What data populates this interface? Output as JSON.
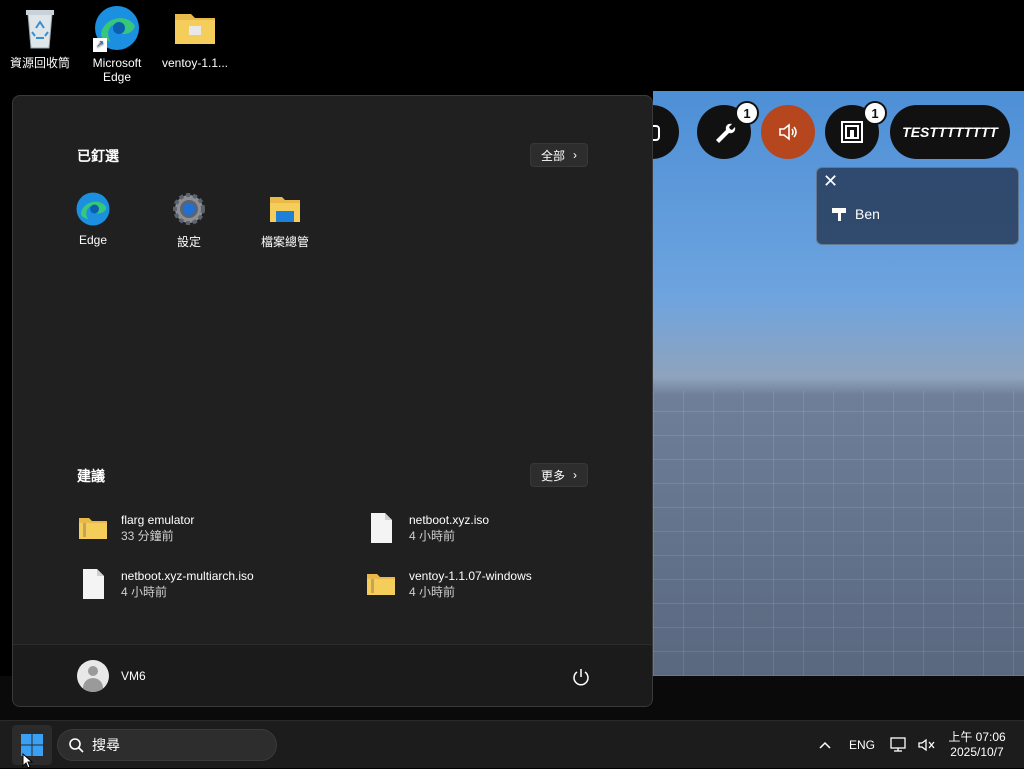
{
  "desktop_icons": [
    {
      "label": "資源回收筒",
      "icon": "recycle-bin-icon"
    },
    {
      "label": "Microsoft\nEdge",
      "icon": "edge-icon"
    },
    {
      "label": "ventoy-1.1...",
      "icon": "folder-icon"
    }
  ],
  "start_menu": {
    "pinned_title": "已釘選",
    "pinned_all_label": "全部",
    "pinned": [
      {
        "label": "Edge",
        "icon": "edge-icon"
      },
      {
        "label": "設定",
        "icon": "settings-gear-icon"
      },
      {
        "label": "檔案總管",
        "icon": "file-explorer-icon"
      }
    ],
    "recommended_title": "建議",
    "recommended_more_label": "更多",
    "recommended": [
      {
        "name": "flarg emulator",
        "time": "33 分鐘前",
        "icon": "zip-folder-icon"
      },
      {
        "name": "netboot.xyz.iso",
        "time": "4 小時前",
        "icon": "file-icon"
      },
      {
        "name": "netboot.xyz-multiarch.iso",
        "time": "4 小時前",
        "icon": "file-icon"
      },
      {
        "name": "ventoy-1.1.07-windows",
        "time": "4 小時前",
        "icon": "zip-folder-icon"
      }
    ],
    "user_name": "VM6"
  },
  "game": {
    "badge_tools": "1",
    "badge_inventory": "1",
    "player_tag": "TESTTTTTTTT",
    "notification_name": "Ben"
  },
  "taskbar": {
    "search_placeholder": "搜尋",
    "language": "ENG",
    "time": "上午 07:06",
    "date": "2025/10/7"
  },
  "colors": {
    "accent_blue": "#0078d4",
    "menu_bg": "#202020",
    "speaker_orange": "#b5461e"
  }
}
